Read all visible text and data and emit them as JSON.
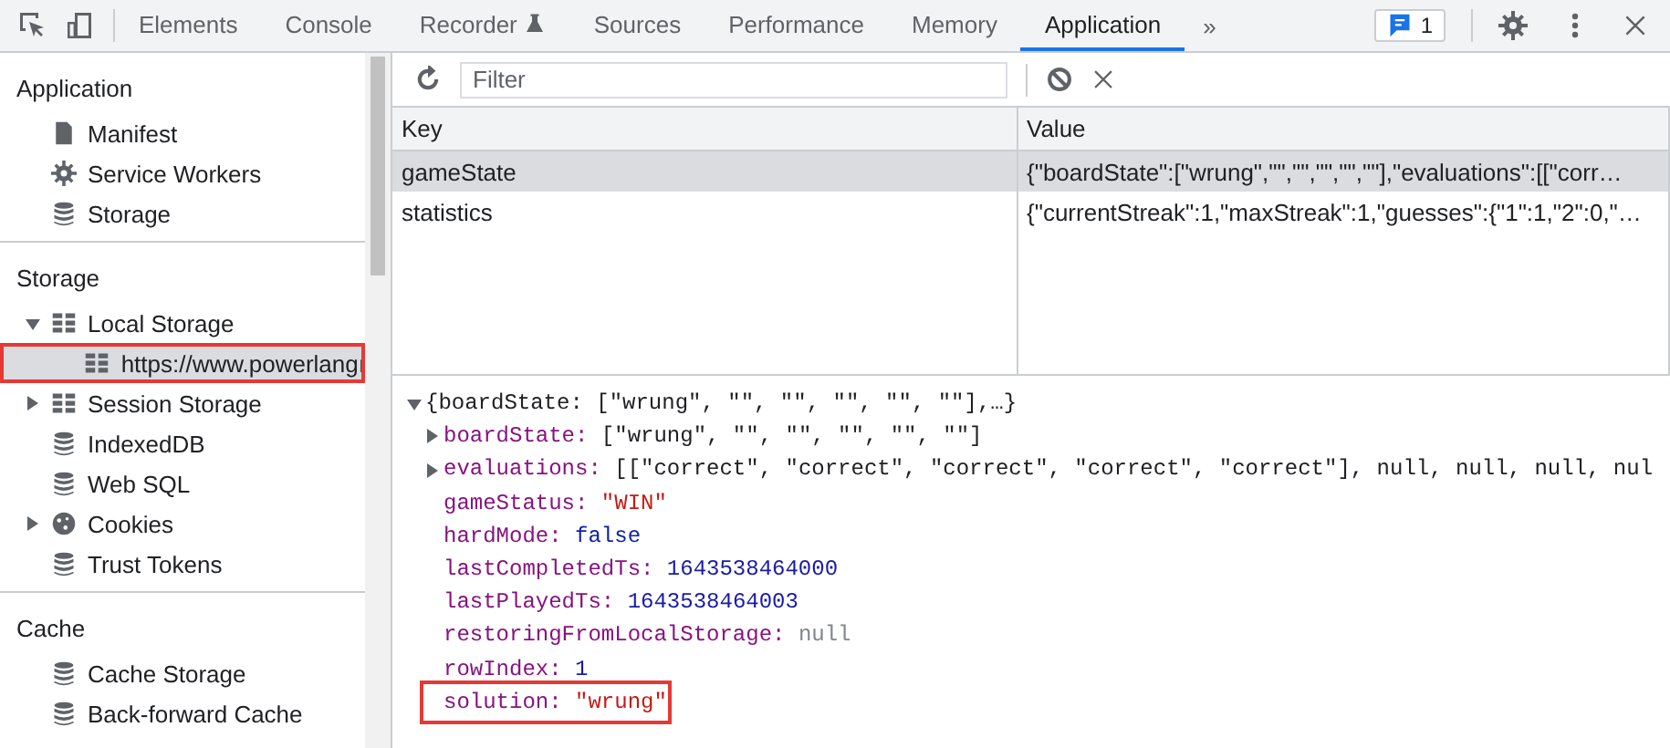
{
  "toolbar": {
    "tabs": [
      {
        "label": "Elements",
        "selected": false,
        "kind": "plain"
      },
      {
        "label": "Console",
        "selected": false,
        "kind": "plain"
      },
      {
        "label": "Recorder",
        "selected": false,
        "kind": "experimental"
      },
      {
        "label": "Sources",
        "selected": false,
        "kind": "plain"
      },
      {
        "label": "Performance",
        "selected": false,
        "kind": "plain"
      },
      {
        "label": "Memory",
        "selected": false,
        "kind": "plain"
      },
      {
        "label": "Application",
        "selected": true,
        "kind": "plain"
      }
    ],
    "more": "»",
    "issues_count": "1"
  },
  "sidebar": {
    "sections": [
      {
        "title": "Application",
        "items": [
          {
            "label": "Manifest",
            "kind": "file",
            "selected": false,
            "highlighted": false
          },
          {
            "label": "Service Workers",
            "kind": "gear",
            "selected": false,
            "highlighted": false
          },
          {
            "label": "Storage",
            "kind": "database",
            "selected": false,
            "highlighted": false
          }
        ]
      },
      {
        "title": "Storage",
        "items": [
          {
            "label": "Local Storage",
            "kind": "table",
            "selected": false,
            "highlighted": false,
            "expanded": true,
            "children": [
              {
                "label": "https://www.powerlangı",
                "kind": "table",
                "selected": true,
                "highlighted": true
              }
            ]
          },
          {
            "label": "Session Storage",
            "kind": "table",
            "selected": false,
            "highlighted": false,
            "expanded": false
          },
          {
            "label": "IndexedDB",
            "kind": "database",
            "selected": false,
            "highlighted": false
          },
          {
            "label": "Web SQL",
            "kind": "database",
            "selected": false,
            "highlighted": false
          },
          {
            "label": "Cookies",
            "kind": "cookie",
            "selected": false,
            "highlighted": false,
            "expanded": false
          },
          {
            "label": "Trust Tokens",
            "kind": "database",
            "selected": false,
            "highlighted": false
          }
        ]
      },
      {
        "title": "Cache",
        "items": [
          {
            "label": "Cache Storage",
            "kind": "database",
            "selected": false,
            "highlighted": false
          },
          {
            "label": "Back-forward Cache",
            "kind": "database",
            "selected": false,
            "highlighted": false
          }
        ]
      }
    ]
  },
  "filter": {
    "placeholder": "Filter"
  },
  "table": {
    "columns": [
      "Key",
      "Value"
    ],
    "rows": [
      {
        "key": "gameState",
        "value": "{\"boardState\":[\"wrung\",\"\",\"\",\"\",\"\",\"\"],\"evaluations\":[[\"corr…",
        "selected": true
      },
      {
        "key": "statistics",
        "value": "{\"currentStreak\":1,\"maxStreak\":1,\"guesses\":{\"1\":1,\"2\":0,\"…",
        "selected": false
      }
    ]
  },
  "preview": {
    "summary": "{boardState: [\"wrung\", \"\", \"\", \"\", \"\", \"\"],…}",
    "expanded": true,
    "properties": [
      {
        "key": "boardState:",
        "value": "[\"wrung\", \"\", \"\", \"\", \"\", \"\"]",
        "kind": "object",
        "expanded": false,
        "highlighted": false
      },
      {
        "key": "evaluations:",
        "value": "[[\"correct\", \"correct\", \"correct\", \"correct\", \"correct\"], null, null, null, nul",
        "kind": "object",
        "expanded": false,
        "highlighted": false
      },
      {
        "key": "gameStatus:",
        "value": "\"WIN\"",
        "kind": "string",
        "highlighted": false
      },
      {
        "key": "hardMode:",
        "value": "false",
        "kind": "boolean",
        "highlighted": false
      },
      {
        "key": "lastCompletedTs:",
        "value": "1643538464000",
        "kind": "number",
        "highlighted": false
      },
      {
        "key": "lastPlayedTs:",
        "value": "1643538464003",
        "kind": "number",
        "highlighted": false
      },
      {
        "key": "restoringFromLocalStorage:",
        "value": "null",
        "kind": "null",
        "highlighted": false
      },
      {
        "key": "rowIndex:",
        "value": "1",
        "kind": "number",
        "highlighted": false
      },
      {
        "key": "solution:",
        "value": "\"wrung\"",
        "kind": "string",
        "highlighted": true
      }
    ]
  }
}
